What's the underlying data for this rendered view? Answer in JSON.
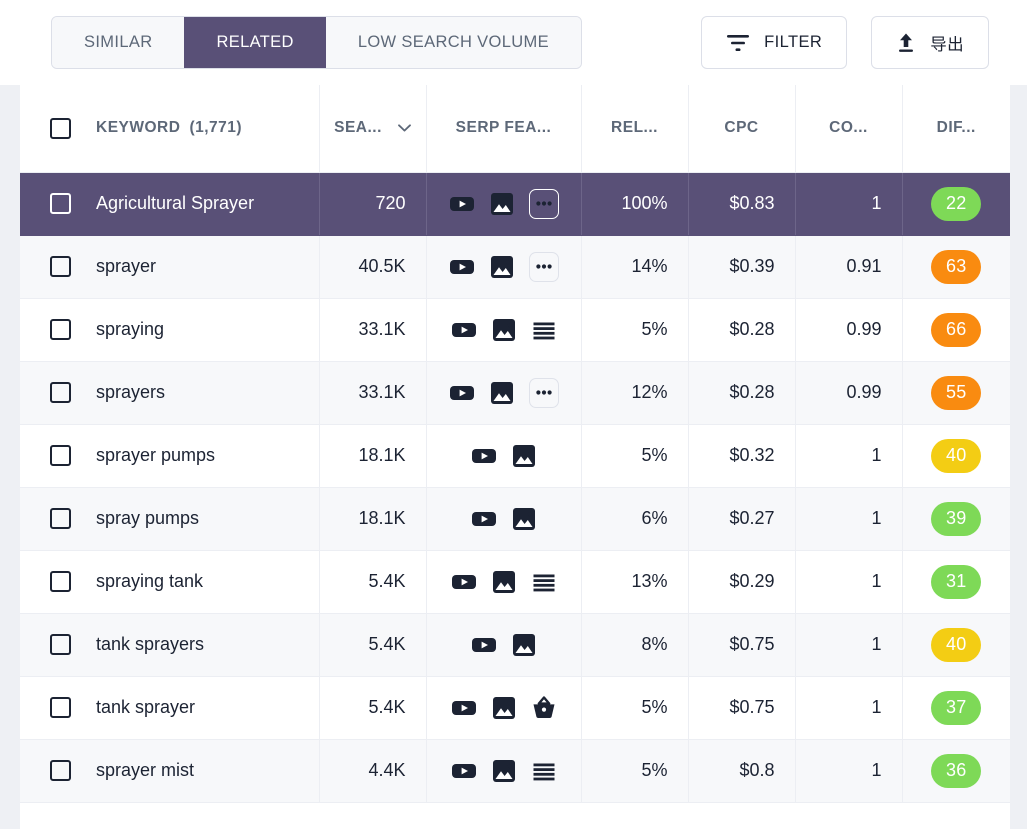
{
  "toolbar": {
    "tabs": [
      {
        "label": "SIMILAR",
        "active": false
      },
      {
        "label": "RELATED",
        "active": true
      },
      {
        "label": "LOW SEARCH VOLUME",
        "active": false
      }
    ],
    "filter_label": "FILTER",
    "export_label": "导出"
  },
  "table": {
    "headers": {
      "keyword": "KEYWORD",
      "keyword_count": "(1,771)",
      "volume": "SEA...",
      "serp": "SERP FEA...",
      "relevance": "REL...",
      "cpc": "CPC",
      "competition": "CO...",
      "difficulty": "DIF..."
    },
    "rows": [
      {
        "keyword": "Agricultural Sprayer",
        "volume": "720",
        "serp": [
          "video-icon",
          "image-icon",
          "more-icon"
        ],
        "relevance": "100%",
        "cpc": "$0.83",
        "competition": "1",
        "difficulty": "22",
        "difficulty_color": "#7ed957",
        "selected": true
      },
      {
        "keyword": "sprayer",
        "volume": "40.5K",
        "serp": [
          "video-icon",
          "image-icon",
          "more-icon"
        ],
        "relevance": "14%",
        "cpc": "$0.39",
        "competition": "0.91",
        "difficulty": "63",
        "difficulty_color": "#f98b10",
        "selected": false
      },
      {
        "keyword": "spraying",
        "volume": "33.1K",
        "serp": [
          "video-icon",
          "image-icon",
          "list-icon"
        ],
        "relevance": "5%",
        "cpc": "$0.28",
        "competition": "0.99",
        "difficulty": "66",
        "difficulty_color": "#f98b10",
        "selected": false
      },
      {
        "keyword": "sprayers",
        "volume": "33.1K",
        "serp": [
          "video-icon",
          "image-icon",
          "more-icon"
        ],
        "relevance": "12%",
        "cpc": "$0.28",
        "competition": "0.99",
        "difficulty": "55",
        "difficulty_color": "#f98b10",
        "selected": false
      },
      {
        "keyword": "sprayer pumps",
        "volume": "18.1K",
        "serp": [
          "video-icon",
          "image-icon"
        ],
        "relevance": "5%",
        "cpc": "$0.32",
        "competition": "1",
        "difficulty": "40",
        "difficulty_color": "#f3cd14",
        "selected": false
      },
      {
        "keyword": "spray pumps",
        "volume": "18.1K",
        "serp": [
          "video-icon",
          "image-icon"
        ],
        "relevance": "6%",
        "cpc": "$0.27",
        "competition": "1",
        "difficulty": "39",
        "difficulty_color": "#7ed957",
        "selected": false
      },
      {
        "keyword": "spraying tank",
        "volume": "5.4K",
        "serp": [
          "video-icon",
          "image-icon",
          "list-icon"
        ],
        "relevance": "13%",
        "cpc": "$0.29",
        "competition": "1",
        "difficulty": "31",
        "difficulty_color": "#7ed957",
        "selected": false
      },
      {
        "keyword": "tank sprayers",
        "volume": "5.4K",
        "serp": [
          "video-icon",
          "image-icon"
        ],
        "relevance": "8%",
        "cpc": "$0.75",
        "competition": "1",
        "difficulty": "40",
        "difficulty_color": "#f3cd14",
        "selected": false
      },
      {
        "keyword": "tank sprayer",
        "volume": "5.4K",
        "serp": [
          "video-icon",
          "image-icon",
          "basket-icon"
        ],
        "relevance": "5%",
        "cpc": "$0.75",
        "competition": "1",
        "difficulty": "37",
        "difficulty_color": "#7ed957",
        "selected": false
      },
      {
        "keyword": "sprayer mist",
        "volume": "4.4K",
        "serp": [
          "video-icon",
          "image-icon",
          "list-icon"
        ],
        "relevance": "5%",
        "cpc": "$0.8",
        "competition": "1",
        "difficulty": "36",
        "difficulty_color": "#7ed957",
        "selected": false
      }
    ]
  },
  "colors": {
    "accent_purple": "#595077",
    "green": "#7ed957",
    "orange": "#f98b10",
    "yellow": "#f3cd14"
  }
}
